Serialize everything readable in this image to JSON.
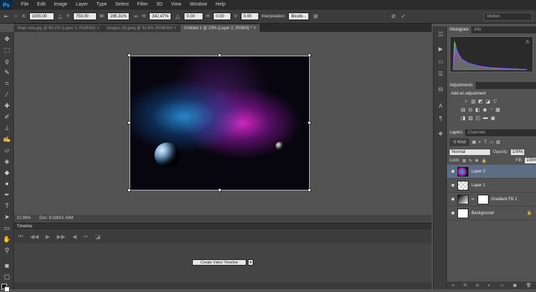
{
  "app": {
    "logo": "Ps"
  },
  "menu": [
    "File",
    "Edit",
    "Image",
    "Layer",
    "Type",
    "Select",
    "Filter",
    "3D",
    "View",
    "Window",
    "Help"
  ],
  "options": {
    "x_label": "X:",
    "x_value": "1000.00 px",
    "y_label": "Y:",
    "y_value": "750.00 px",
    "w_label": "W:",
    "w_value": "285.31%",
    "h_label": "H:",
    "h_value": "342.47%",
    "angle_value": "0.00",
    "hskew_label": "H:",
    "hskew_value": "0.00",
    "vskew_label": "V:",
    "vskew_value": "0.00",
    "interp_label": "Interpolation:",
    "interp_value": "Bicubi..."
  },
  "workspace": "Motion",
  "tabs": [
    {
      "label": "fikap nola.jpg @ 69.2% (Layer 1, RGB/8#) ×",
      "active": false
    },
    {
      "label": "images (9).jpeg @ 82.6% (RGB/8#) ×",
      "active": false
    },
    {
      "label": "Untitled-1 @ 23% (Layer 2, RGB/8) * ×",
      "active": true
    }
  ],
  "status": {
    "zoom": "22.96%",
    "doc": "Doc: 8.58M/1.54M"
  },
  "timeline": {
    "title": "Timeline",
    "create_button": "Create Video Timeline"
  },
  "panels": {
    "histogram_tab": "Histogram",
    "info_tab": "Info",
    "adjustments_tab": "Adjustments",
    "adjustments_title": "Add an adjustment",
    "layers_tab": "Layers",
    "channels_tab": "Channels",
    "kind": "Kind",
    "blend_mode": "Normal",
    "opacity_label": "Opacity:",
    "opacity_value": "100%",
    "lock_label": "Lock:",
    "fill_label": "Fill:",
    "fill_value": "100%"
  },
  "layers": [
    {
      "name": "Layer 2",
      "selected": true
    },
    {
      "name": "Layer 1",
      "selected": false
    },
    {
      "name": "Gradient Fill 1",
      "selected": false
    },
    {
      "name": "Background",
      "selected": false
    }
  ]
}
